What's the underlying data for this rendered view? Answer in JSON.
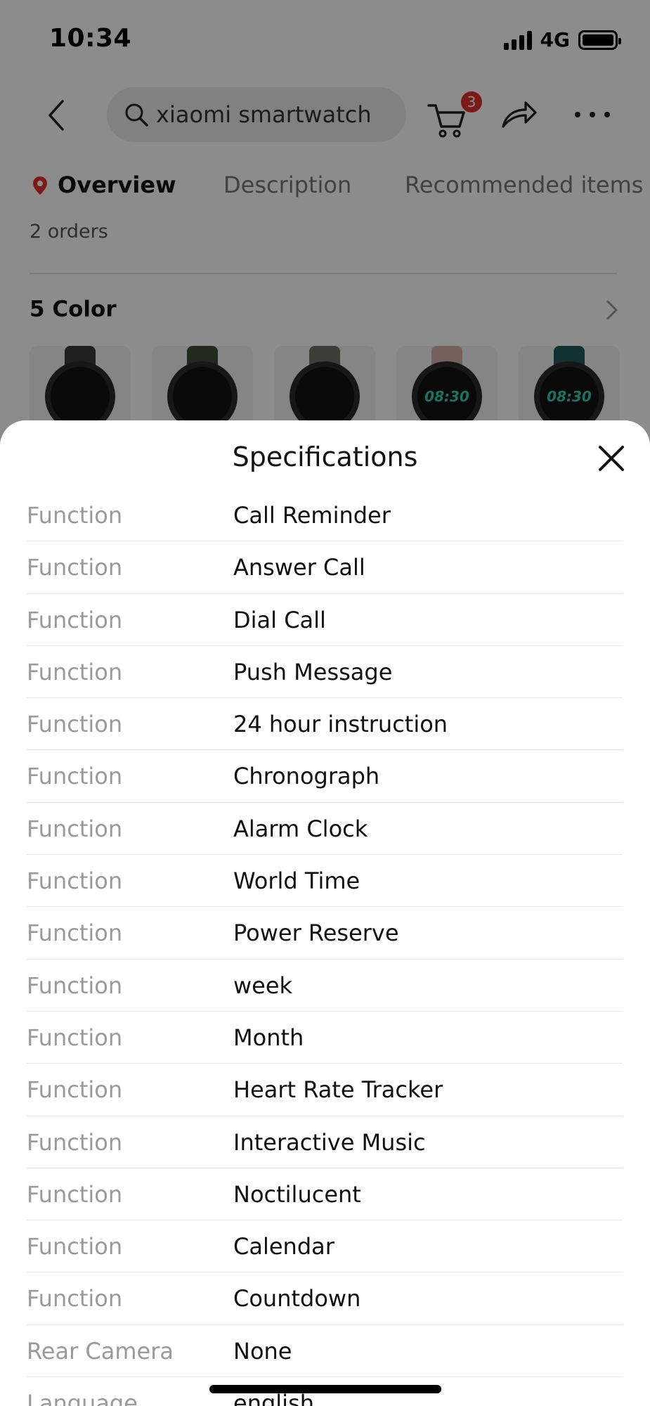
{
  "status_bar": {
    "time": "10:34",
    "network": "4G"
  },
  "search": {
    "query": "xiaomi smartwatch"
  },
  "cart": {
    "badge_count": "3"
  },
  "tabs": [
    {
      "label": "Overview"
    },
    {
      "label": "Description"
    },
    {
      "label": "Recommended items"
    }
  ],
  "product": {
    "orders": "2 orders",
    "color_title": "5 Color",
    "swatches": [
      {
        "band_color": "#3a3a3a",
        "face_text": ""
      },
      {
        "band_color": "#3f4e36",
        "face_text": ""
      },
      {
        "band_color": "#6e7264",
        "face_text": ""
      },
      {
        "band_color": "#d8b0a6",
        "face_text": "08:30"
      },
      {
        "band_color": "#1f5a5c",
        "face_text": "08:30"
      }
    ]
  },
  "sheet": {
    "title": "Specifications",
    "rows": [
      {
        "key": "Function",
        "value": "Call Reminder"
      },
      {
        "key": "Function",
        "value": "Answer Call"
      },
      {
        "key": "Function",
        "value": "Dial Call"
      },
      {
        "key": "Function",
        "value": "Push Message"
      },
      {
        "key": "Function",
        "value": "24 hour instruction"
      },
      {
        "key": "Function",
        "value": "Chronograph"
      },
      {
        "key": "Function",
        "value": "Alarm Clock"
      },
      {
        "key": "Function",
        "value": "World Time"
      },
      {
        "key": "Function",
        "value": "Power Reserve"
      },
      {
        "key": "Function",
        "value": "week"
      },
      {
        "key": "Function",
        "value": "Month"
      },
      {
        "key": "Function",
        "value": "Heart Rate Tracker"
      },
      {
        "key": "Function",
        "value": "Interactive Music"
      },
      {
        "key": "Function",
        "value": "Noctilucent"
      },
      {
        "key": "Function",
        "value": "Calendar"
      },
      {
        "key": "Function",
        "value": "Countdown"
      },
      {
        "key": "Rear Camera",
        "value": "None"
      },
      {
        "key": "Language",
        "value": "english"
      }
    ]
  },
  "colors": {
    "badge": "#e62e2e",
    "pin": "#e62e2e",
    "overlay": "rgba(0,0,0,0.45)"
  }
}
